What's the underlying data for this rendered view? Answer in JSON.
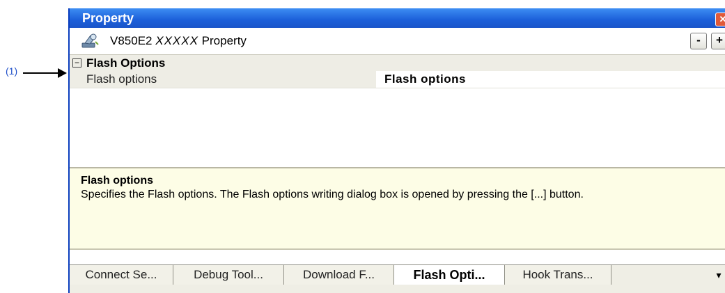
{
  "callout": {
    "label": "(1)"
  },
  "window": {
    "title": "Property",
    "close_label": "✕",
    "header": {
      "title_prefix": "V850E2",
      "title_italic": "XXXXX",
      "title_suffix": "Property",
      "minus_label": "-",
      "plus_label": "+"
    },
    "grid": {
      "category": {
        "toggle": "−",
        "label": "Flash Options"
      },
      "rows": [
        {
          "name": "Flash options",
          "value": "Flash options"
        }
      ]
    },
    "description": {
      "title": "Flash options",
      "text": "Specifies the Flash options. The Flash options writing  dialog box is opened by pressing the [...] button."
    },
    "tabs": [
      {
        "label": "Connect Se..."
      },
      {
        "label": "Debug Tool..."
      },
      {
        "label": "Download F..."
      },
      {
        "label": "Flash Opti..."
      },
      {
        "label": "Hook Trans..."
      }
    ],
    "tabs_more": "▾"
  }
}
